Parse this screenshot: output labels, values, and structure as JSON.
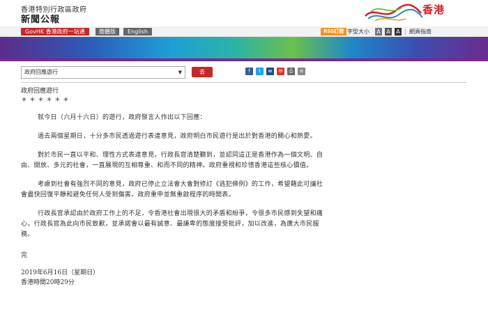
{
  "header": {
    "dept_line1": "香港特別行政區政府",
    "dept_line2": "新聞公報",
    "brand": "香港"
  },
  "nav": {
    "gov_portal": "GovHK 香港政府一站通",
    "simplified": "簡體版",
    "english": "English",
    "rss": "RSS訂閱",
    "font_size_label": "字型大小",
    "font_a1": "A",
    "font_a2": "A",
    "font_a3": "A",
    "separator": "|",
    "guide": "網頁指南"
  },
  "toolbar": {
    "select_value": "政府回應遊行",
    "go_label": "去"
  },
  "share": {
    "fb": "f",
    "tw": "t",
    "wb": "w",
    "em": "✉",
    "pr": "⎙",
    "ln": "≡"
  },
  "article": {
    "title": "政府回應遊行",
    "stars": "＊＊＊＊＊＊",
    "paragraphs": [
      "就今日（六月十六日）的遊行，政府發言人作出以下回應：",
      "過去兩個星期日，十分多市民透過遊行表達意見，政府明白市民遊行是出於對香港的關心和熱愛。",
      "對於市民一直以平和、理性方式表達意見，行政長官清楚聽到，並認同這正是香港作為一個文明、自由、開放、多元的社會，一直展現的互相尊重、和而不同的精神。政府重視和珍惜香港這些核心價值。",
      "考慮到社會有強烈不同的意見，政府已停止立法會大會對修訂《逃犯條例》的工作，希望藉此可讓社會盡快回復平靜和避免任何人受到傷害。政府重申並無重啟程序的時間表。",
      "行政長官承認由於政府工作上的不足，令香港社會出現很大的矛盾和紛爭，令很多市民感到失望和痛心，行政長官為此向市民致歉，並承諾會以最有誠意、最謙卑的態度接受批評，加以改進，為廣大市民服務。"
    ],
    "end": "完",
    "date": "2019年6月16日（星期日）",
    "time": "香港時間20時29分"
  }
}
